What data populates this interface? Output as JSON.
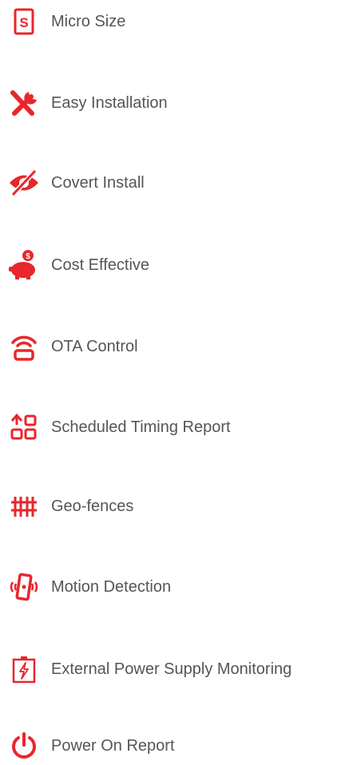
{
  "accent_color": "#e8262b",
  "text_color": "#555555",
  "features": [
    {
      "label": "Micro Size",
      "icon": "micro-size-icon"
    },
    {
      "label": "Easy Installation",
      "icon": "tools-icon"
    },
    {
      "label": "Covert Install",
      "icon": "eye-slash-icon"
    },
    {
      "label": "Cost Effective",
      "icon": "piggy-bank-icon"
    },
    {
      "label": "OTA Control",
      "icon": "router-signal-icon"
    },
    {
      "label": "Scheduled Timing Report",
      "icon": "scheduled-report-icon"
    },
    {
      "label": "Geo-fences",
      "icon": "fence-icon"
    },
    {
      "label": "Motion Detection",
      "icon": "vibrating-device-icon"
    },
    {
      "label": "External Power Supply Monitoring",
      "icon": "battery-bolt-icon"
    },
    {
      "label": "Power On Report",
      "icon": "power-icon"
    }
  ]
}
